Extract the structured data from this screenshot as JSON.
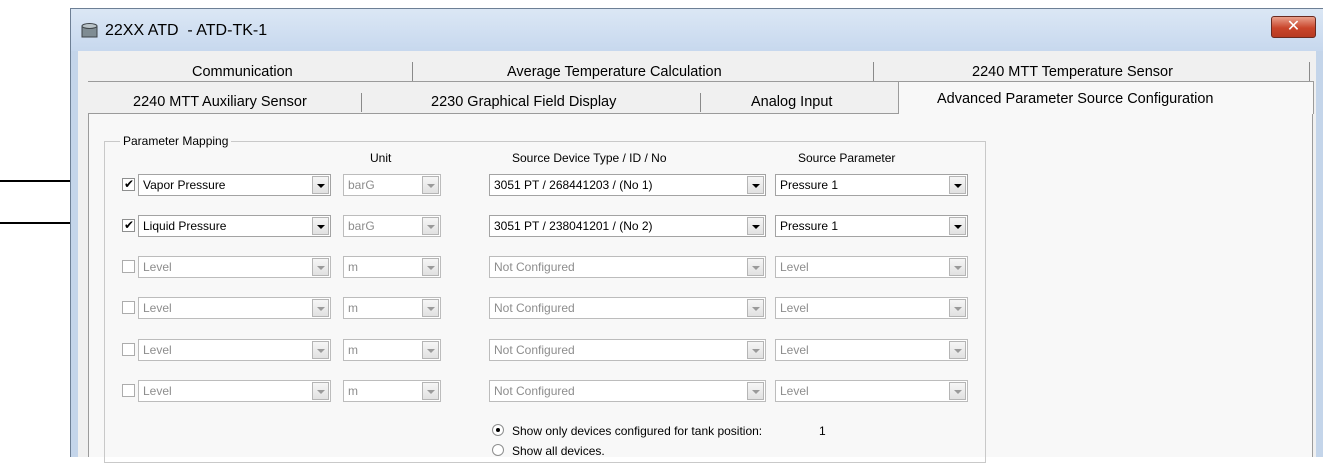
{
  "window": {
    "title": "22XX ATD  - ATD-TK-1",
    "close_label": "✕",
    "icon": "database-icon"
  },
  "tabs": {
    "row1": [
      "Communication",
      "Average Temperature Calculation",
      "2240 MTT Temperature Sensor"
    ],
    "row2": [
      "2240 MTT Auxiliary Sensor",
      "2230 Graphical Field Display",
      "Analog Input"
    ],
    "active": "Advanced Parameter Source Configuration"
  },
  "group": {
    "label": "Parameter Mapping",
    "headers": {
      "unit": "Unit",
      "source_device": "Source Device Type / ID / No",
      "source_parameter": "Source Parameter"
    }
  },
  "rows": [
    {
      "checked": true,
      "check_glyph": "✔",
      "parameter": "Vapor Pressure",
      "unit": "barG",
      "device": "3051  PT / 268441203 / (No 1)",
      "source_param": "Pressure 1"
    },
    {
      "checked": true,
      "check_glyph": "✔",
      "parameter": "Liquid Pressure",
      "unit": "barG",
      "device": "3051  PT / 238041201 / (No 2)",
      "source_param": "Pressure 1"
    },
    {
      "checked": false,
      "check_glyph": "",
      "parameter": "Level",
      "unit": "m",
      "device": "Not Configured",
      "source_param": "Level"
    },
    {
      "checked": false,
      "check_glyph": "",
      "parameter": "Level",
      "unit": "m",
      "device": "Not Configured",
      "source_param": "Level"
    },
    {
      "checked": false,
      "check_glyph": "",
      "parameter": "Level",
      "unit": "m",
      "device": "Not Configured",
      "source_param": "Level"
    },
    {
      "checked": false,
      "check_glyph": "",
      "parameter": "Level",
      "unit": "m",
      "device": "Not Configured",
      "source_param": "Level"
    }
  ],
  "filter": {
    "option_tank": "Show only devices configured for tank position:",
    "tank_position": "1",
    "option_all": "Show all devices.",
    "selected": "tank"
  }
}
